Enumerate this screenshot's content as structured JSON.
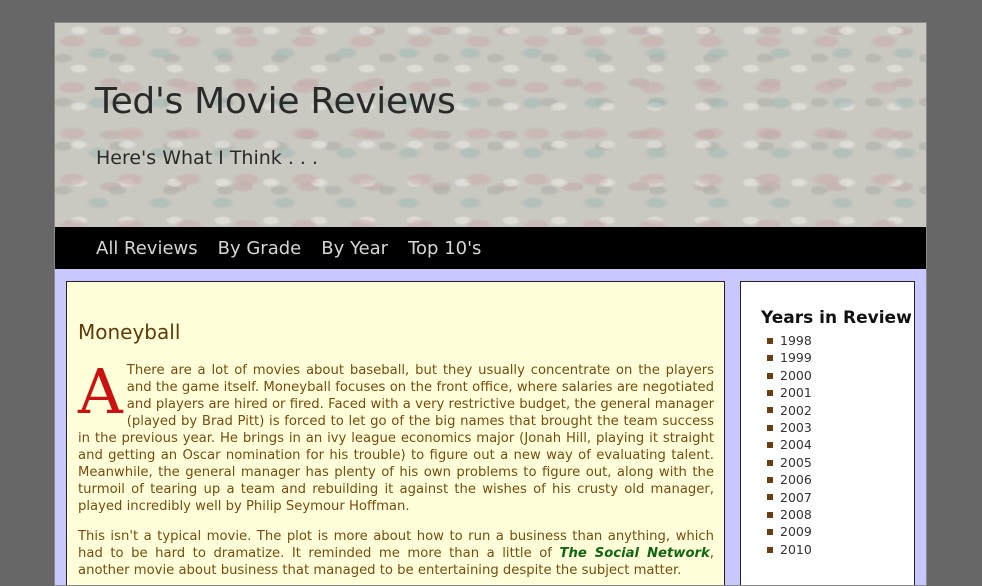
{
  "header": {
    "title": "Ted's Movie Reviews",
    "tagline": "Here's What I Think . . ."
  },
  "nav": {
    "items": [
      {
        "label": "All Reviews"
      },
      {
        "label": "By Grade"
      },
      {
        "label": "By Year"
      },
      {
        "label": "Top 10's"
      }
    ]
  },
  "post": {
    "title": "Moneyball",
    "dropcap": "A",
    "paragraph1": "There are a lot of movies about baseball, but they usually concentrate on the players and the game itself. Moneyball focuses on the front office, where salaries are negotiated and players are hired or fired. Faced with a very restrictive budget, the general manager (played by Brad Pitt) is forced to let go of the big names that brought the team success in the previous year. He brings in an ivy league economics major (Jonah Hill, playing it straight and getting an Oscar nomination for his trouble) to figure out a new way of evaluating talent. Meanwhile, the general manager has plenty of his own problems to figure out, along with the turmoil of tearing up a team and rebuilding it against the wishes of his crusty old manager, played incredibly well by Philip Seymour Hoffman.",
    "paragraph2_start": "This isn't a typical movie. The plot is more about how to run a business than anything, which had to be hard to dramatize. It reminded me more than a little of ",
    "paragraph2_link": "The Social Network",
    "paragraph2_end": ", another movie about business that managed to be entertaining despite the subject matter."
  },
  "sidebar": {
    "heading": "Years in Review",
    "years": [
      "1998",
      "1999",
      "2000",
      "2001",
      "2002",
      "2003",
      "2004",
      "2005",
      "2006",
      "2007",
      "2008",
      "2009",
      "2010"
    ]
  },
  "colors": {
    "background": "#676767",
    "content_panel": "#ffffda",
    "nav_bar": "#000000",
    "dropcap": "#cc1111",
    "link": "#116611",
    "frame": "#c8c8fe"
  }
}
